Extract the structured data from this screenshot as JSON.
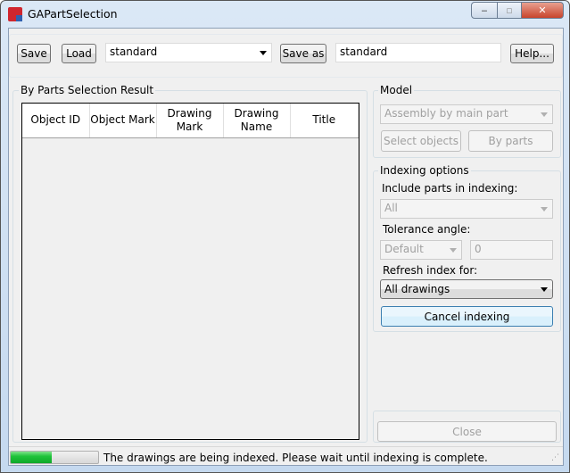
{
  "window": {
    "title": "GAPartSelection",
    "minimize": "‒",
    "maximize": "▫",
    "close": "✕"
  },
  "toolbar": {
    "save_label": "Save",
    "load_label": "Load",
    "profile_value": "standard",
    "save_as_label": "Save as",
    "save_as_value": "standard",
    "help_label": "Help..."
  },
  "results": {
    "title": "By Parts Selection Result",
    "columns": [
      "Object ID",
      "Object Mark",
      "Drawing Mark",
      "Drawing Name",
      "Title"
    ]
  },
  "model": {
    "title": "Model",
    "mode_value": "Assembly by main part",
    "select_objects_label": "Select objects",
    "by_parts_label": "By parts"
  },
  "indexing": {
    "title": "Indexing options",
    "include_label": "Include parts in indexing:",
    "include_value": "All",
    "tolerance_label": "Tolerance angle:",
    "tolerance_mode": "Default",
    "tolerance_value": "0",
    "refresh_label": "Refresh index for:",
    "refresh_value": "All drawings",
    "cancel_label": "Cancel indexing"
  },
  "close_label": "Close",
  "status": {
    "progress_percent": 47,
    "message": "The drawings are being indexed. Please wait until indexing is complete.",
    "progress_color": "#1fc33a"
  }
}
